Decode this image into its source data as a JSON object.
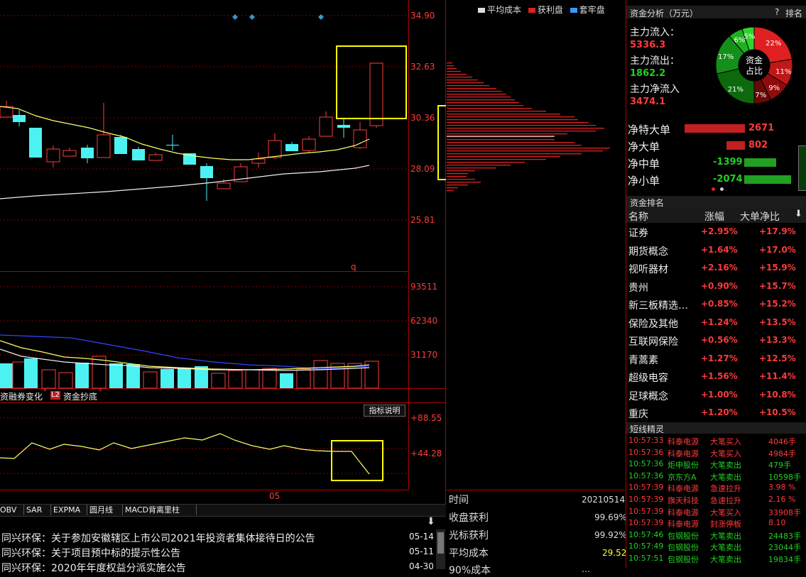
{
  "price_axis": [
    "34.90",
    "32.63",
    "30.36",
    "28.09",
    "25.81"
  ],
  "volume_axis": [
    "93511",
    "62340",
    "31170"
  ],
  "indicator_axis": [
    "+88.55",
    "+44.28"
  ],
  "date_marker": "05",
  "marker_q": "q",
  "indicator_tabs": {
    "tab1": "资融券变化",
    "tab2_badge": "L2",
    "tab2": "资金抄底",
    "info_button": "指标说明"
  },
  "bottom_tabs": [
    "OBV",
    "SAR",
    "EXPMA",
    "圆月线",
    "MACD背离里柱"
  ],
  "news": [
    {
      "title": "同兴环保：关于参加安徽辖区上市公司2021年投资者集体接待日的公告",
      "date": "05-14"
    },
    {
      "title": "同兴环保：关于项目预中标的提示性公告",
      "date": "05-11"
    },
    {
      "title": "同兴环保：2020年年度权益分派实施公告",
      "date": "04-30"
    }
  ],
  "chip_legend": {
    "avg": "平均成本",
    "profit": "获利盘",
    "trapped": "套牢盘"
  },
  "chip_info": [
    {
      "label": "时间",
      "value": "20210514"
    },
    {
      "label": "收盘获利",
      "value": "99.69%"
    },
    {
      "label": "光标获利",
      "value": "99.92%"
    },
    {
      "label": "平均成本",
      "value": "29.52"
    },
    {
      "label": "90%成本",
      "value": "…"
    }
  ],
  "fund_analysis": {
    "title": "资金分析（万元）",
    "help": "?",
    "rank_btn": "排名",
    "inflow_label": "主力流入：",
    "inflow_value": "5336.3",
    "outflow_label": "主力流出：",
    "outflow_value": "1862.2",
    "net_label": "主力净流入",
    "net_value": "3474.1",
    "donut_center_1": "资金",
    "donut_center_2": "占比",
    "donut_segments": [
      {
        "pct": "22%",
        "value": 22,
        "color": "#e02020"
      },
      {
        "pct": "11%",
        "value": 11,
        "color": "#c01818"
      },
      {
        "pct": "9%",
        "value": 9,
        "color": "#900c0c"
      },
      {
        "pct": "7%",
        "value": 7,
        "color": "#6a0808"
      },
      {
        "pct": "21%",
        "value": 21,
        "color": "#0c6a0c"
      },
      {
        "pct": "17%",
        "value": 17,
        "color": "#14901a"
      },
      {
        "pct": "6%",
        "value": 6,
        "color": "#1fb020"
      },
      {
        "pct": "5%",
        "value": 5,
        "color": "#2cd42c"
      }
    ],
    "net_rows": [
      {
        "label": "净特大单",
        "value": "2671",
        "num": 2671,
        "color": "#c02020",
        "vcolor": "#ff3b3b"
      },
      {
        "label": "净大单",
        "value": "802",
        "num": 802,
        "color": "#c02020",
        "vcolor": "#ff3b3b"
      },
      {
        "label": "净中单",
        "value": "-1399",
        "num": 1399,
        "color": "#22a022",
        "vcolor": "#22d022"
      },
      {
        "label": "净小单",
        "value": "-2074",
        "num": 2074,
        "color": "#22a022",
        "vcolor": "#22d022"
      }
    ]
  },
  "fund_rank": {
    "title": "资金排名",
    "headers": [
      "名称",
      "涨幅",
      "大单净比"
    ],
    "sort_icon": "down-arrow",
    "rows": [
      {
        "name": "证券",
        "pct": "+2.95%",
        "net": "+17.9%"
      },
      {
        "name": "期货概念",
        "pct": "+1.64%",
        "net": "+17.0%"
      },
      {
        "name": "视听器材",
        "pct": "+2.16%",
        "net": "+15.9%"
      },
      {
        "name": "贵州",
        "pct": "+0.90%",
        "net": "+15.7%"
      },
      {
        "name": "新三板精选…",
        "pct": "+0.85%",
        "net": "+15.2%"
      },
      {
        "name": "保险及其他",
        "pct": "+1.24%",
        "net": "+13.5%"
      },
      {
        "name": "互联网保险",
        "pct": "+0.56%",
        "net": "+13.3%"
      },
      {
        "name": "青蒿素",
        "pct": "+1.27%",
        "net": "+12.5%"
      },
      {
        "name": "超级电容",
        "pct": "+1.56%",
        "net": "+11.4%"
      },
      {
        "name": "足球概念",
        "pct": "+1.00%",
        "net": "+10.8%"
      },
      {
        "name": "重庆",
        "pct": "+1.20%",
        "net": "+10.5%"
      }
    ]
  },
  "short_line": {
    "title": "短线精灵",
    "rows": [
      {
        "time": "10:57:33",
        "stock": "科泰电源",
        "event": "大笔买入",
        "val": "4046手",
        "up": true
      },
      {
        "time": "10:57:36",
        "stock": "科泰电源",
        "event": "大笔买入",
        "val": "4984手",
        "up": true
      },
      {
        "time": "10:57:36",
        "stock": "炬申股份",
        "event": "大笔卖出",
        "val": "479手",
        "up": false
      },
      {
        "time": "10:57:36",
        "stock": "京东方A",
        "event": "大笔卖出",
        "val": "10598手",
        "up": false
      },
      {
        "time": "10:57:39",
        "stock": "科泰电源",
        "event": "急速拉升",
        "val": "3.98 %",
        "up": true
      },
      {
        "time": "10:57:39",
        "stock": "旗天科技",
        "event": "急速拉升",
        "val": "2.16 %",
        "up": true
      },
      {
        "time": "10:57:39",
        "stock": "科泰电源",
        "event": "大笔买入",
        "val": "33908手",
        "up": true
      },
      {
        "time": "10:57:39",
        "stock": "科泰电源",
        "event": "封涨停板",
        "val": "8.10",
        "up": true
      },
      {
        "time": "10:57:46",
        "stock": "包钢股份",
        "event": "大笔卖出",
        "val": "24483手",
        "up": false
      },
      {
        "time": "10:57:49",
        "stock": "包钢股份",
        "event": "大笔卖出",
        "val": "23044手",
        "up": false
      },
      {
        "time": "10:57:51",
        "stock": "包钢股份",
        "event": "大笔卖出",
        "val": "19834手",
        "up": false
      }
    ]
  }
}
